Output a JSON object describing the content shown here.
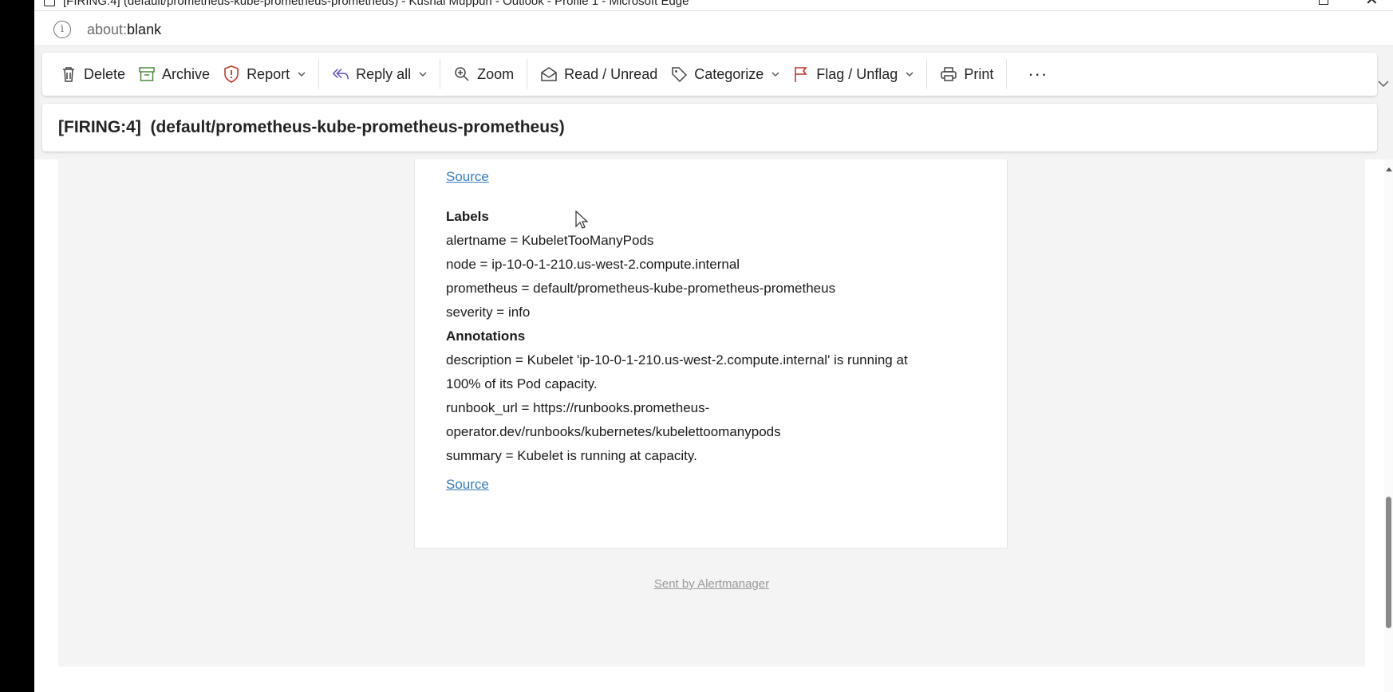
{
  "window": {
    "title": "[FIRING:4] (default/prometheus-kube-prometheus-prometheus) - Kushal Muppuri - Outlook - Profile 1 - Microsoft Edge"
  },
  "address_bar": {
    "scheme": "about:",
    "path": "blank"
  },
  "toolbar": {
    "delete": "Delete",
    "archive": "Archive",
    "report": "Report",
    "reply_all": "Reply all",
    "zoom": "Zoom",
    "read_unread": "Read / Unread",
    "categorize": "Categorize",
    "flag_unflag": "Flag / Unflag",
    "print": "Print",
    "more": "···"
  },
  "subject": "[FIRING:4]  (default/prometheus-kube-prometheus-prometheus)",
  "email": {
    "source_top": "Source",
    "labels_heading": "Labels",
    "labels": [
      "alertname = KubeletTooManyPods",
      "node = ip-10-0-1-210.us-west-2.compute.internal",
      "prometheus = default/prometheus-kube-prometheus-prometheus",
      "severity = info"
    ],
    "annotations_heading": "Annotations",
    "annotation_lines": [
      "description = Kubelet 'ip-10-0-1-210.us-west-2.compute.internal' is running at",
      "100% of its Pod capacity.",
      "runbook_url = https://runbooks.prometheus-",
      "operator.dev/runbooks/kubernetes/kubelettoomanypods",
      "summary = Kubelet is running at capacity."
    ],
    "source_bottom": "Source",
    "footer": "Sent by Alertmanager"
  },
  "colors": {
    "link": "#3a7bbf",
    "report_icon": "#c0392b",
    "archive_icon": "#4a8a3a",
    "reply_icon": "#5b4fbf",
    "flag_icon": "#c0392b"
  }
}
